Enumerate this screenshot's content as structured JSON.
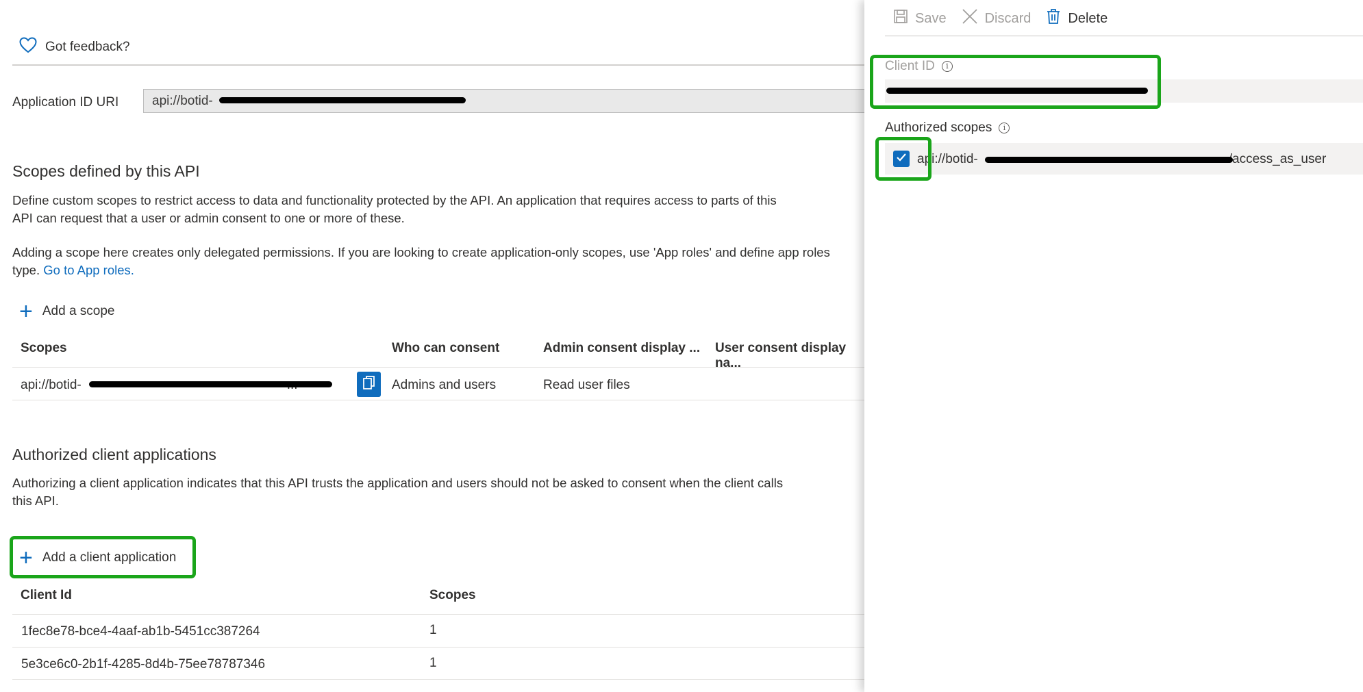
{
  "feedback": {
    "label": "Got feedback?"
  },
  "app_id_uri": {
    "label": "Application ID URI",
    "value_prefix": "api://botid-"
  },
  "scopes_section": {
    "title": "Scopes defined by this API",
    "desc1_line1": "Define custom scopes to restrict access to data and functionality protected by the API. An application that requires access to parts of this",
    "desc1_line2": "API can request that a user or admin consent to one or more of these.",
    "desc2_line1": "Adding a scope here creates only delegated permissions. If you are looking to create application-only scopes, use 'App roles' and define app roles",
    "desc2_line2_text": "type.",
    "desc2_link": "Go to App roles.",
    "add_scope": "Add a scope",
    "columns": [
      "Scopes",
      "Who can consent",
      "Admin consent display ...",
      "User consent display na..."
    ],
    "rows": [
      {
        "scope_prefix": "api://botid-",
        "scope_suffix": "...",
        "who": "Admins and users",
        "admin_display": "Read user files",
        "user_display": ""
      }
    ]
  },
  "client_apps_section": {
    "title": "Authorized client applications",
    "desc_line1": "Authorizing a client application indicates that this API trusts the application and users should not be asked to consent when the client calls",
    "desc_line2": "this API.",
    "add_client": "Add a client application",
    "columns": [
      "Client Id",
      "Scopes"
    ],
    "rows": [
      {
        "client_id": "1fec8e78-bce4-4aaf-ab1b-5451cc387264",
        "scopes": "1"
      },
      {
        "client_id": "5e3ce6c0-2b1f-4285-8d4b-75ee78787346",
        "scopes": "1"
      }
    ]
  },
  "panel": {
    "toolbar": {
      "save": "Save",
      "discard": "Discard",
      "delete": "Delete"
    },
    "client_id_label": "Client ID",
    "authorized_scopes_label": "Authorized scopes",
    "scope_item": {
      "prefix": "api://botid-",
      "suffix": "/access_as_user",
      "checked": true
    }
  },
  "colors": {
    "accent": "#0f6cbd",
    "highlight": "#1aa51a"
  }
}
